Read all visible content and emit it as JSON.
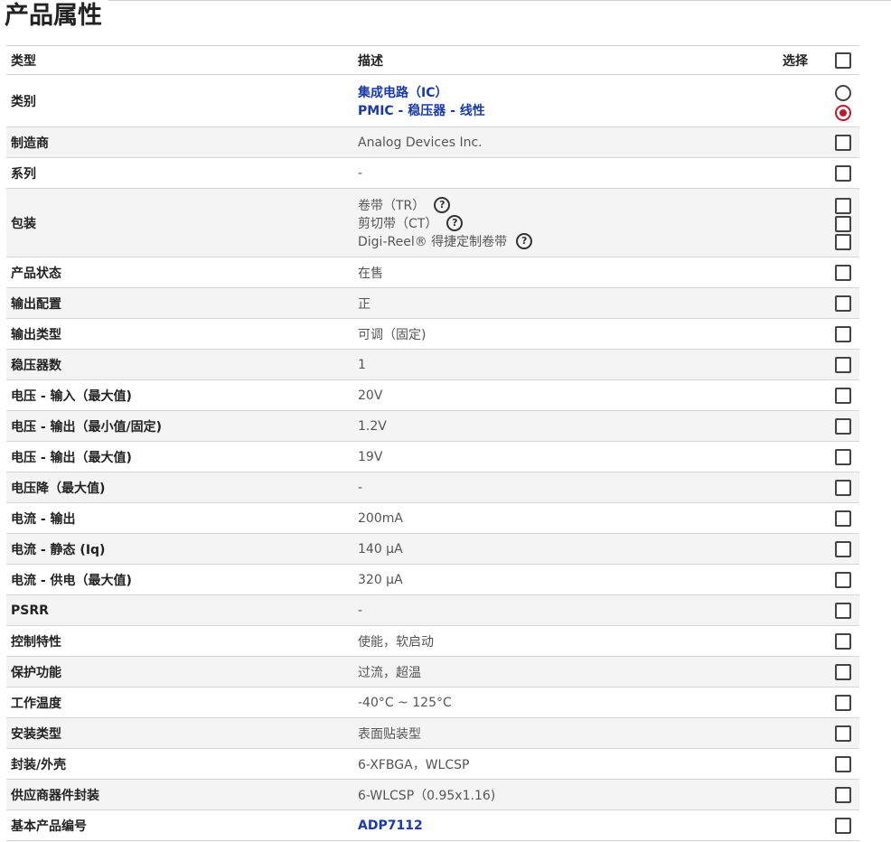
{
  "page_title": "产品属性",
  "table": {
    "header": {
      "type": "类型",
      "description": "描述",
      "select": "选择"
    },
    "category": {
      "label": "类别",
      "values": [
        "集成电路（IC）",
        "PMIC - 稳压器 - 线性"
      ],
      "selected_index": 1
    },
    "packaging": {
      "label": "包装",
      "values": [
        "卷带（TR）",
        "剪切带（CT）",
        "Digi-Reel® 得捷定制卷带"
      ]
    },
    "rows": [
      {
        "label": "制造商",
        "value": "Analog Devices Inc."
      },
      {
        "label": "系列",
        "value": "-"
      },
      {
        "label": "产品状态",
        "value": "在售"
      },
      {
        "label": "输出配置",
        "value": "正"
      },
      {
        "label": "输出类型",
        "value": "可调（固定)"
      },
      {
        "label": "稳压器数",
        "value": "1"
      },
      {
        "label": "电压 - 输入（最大值)",
        "value": "20V"
      },
      {
        "label": "电压 - 输出（最小值/固定)",
        "value": "1.2V"
      },
      {
        "label": "电压 - 输出（最大值)",
        "value": "19V"
      },
      {
        "label": "电压降（最大值)",
        "value": "-"
      },
      {
        "label": "电流 - 输出",
        "value": "200mA"
      },
      {
        "label": "电流 - 静态 (Iq)",
        "value": "140 µA"
      },
      {
        "label": "电流 - 供电（最大值)",
        "value": "320 µA"
      },
      {
        "label": "PSRR",
        "value": "-"
      },
      {
        "label": "控制特性",
        "value": "使能，软启动"
      },
      {
        "label": "保护功能",
        "value": "过流，超温"
      },
      {
        "label": "工作温度",
        "value": "-40°C ~ 125°C"
      },
      {
        "label": "安装类型",
        "value": "表面贴装型"
      },
      {
        "label": "封装/外壳",
        "value": "6-XFBGA，WLCSP"
      },
      {
        "label": "供应商器件封装",
        "value": "6-WLCSP（0.95x1.16)"
      },
      {
        "label": "基本产品编号",
        "value": "ADP7112",
        "is_link": true
      }
    ]
  },
  "icons": {
    "help": "question-circle-icon"
  },
  "colors": {
    "link": "#1a3aa6",
    "radio_selected": "#c0192a",
    "alt_row": "#f4f4f4"
  }
}
